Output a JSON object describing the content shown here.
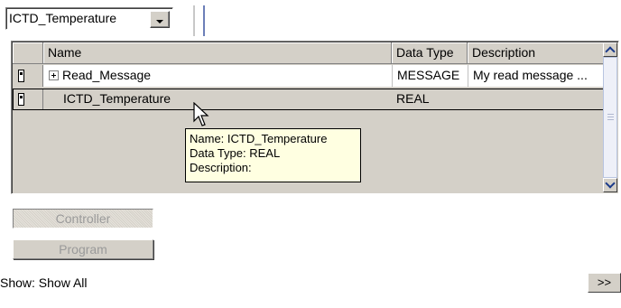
{
  "scope_combo": {
    "value": "ICTD_Temperature"
  },
  "grid": {
    "columns": [
      "Name",
      "Data Type",
      "Description"
    ],
    "rows": [
      {
        "name": "Read_Message",
        "data_type": "MESSAGE",
        "description": "My read message ...",
        "expandable": true,
        "selected": false
      },
      {
        "name": "ICTD_Temperature",
        "data_type": "REAL",
        "description": "",
        "expandable": false,
        "selected": true
      }
    ]
  },
  "tooltip": {
    "name_line": "Name: ICTD_Temperature",
    "type_line": "Data Type: REAL",
    "desc_line": "Description:"
  },
  "buttons": {
    "controller": "Controller",
    "program": "Program",
    "more": ">>"
  },
  "show_filter": {
    "label": "Show: Show All"
  },
  "icons": {
    "tag": "tag-icon",
    "expand": "plus-icon",
    "cursor": "mouse-pointer-icon"
  }
}
